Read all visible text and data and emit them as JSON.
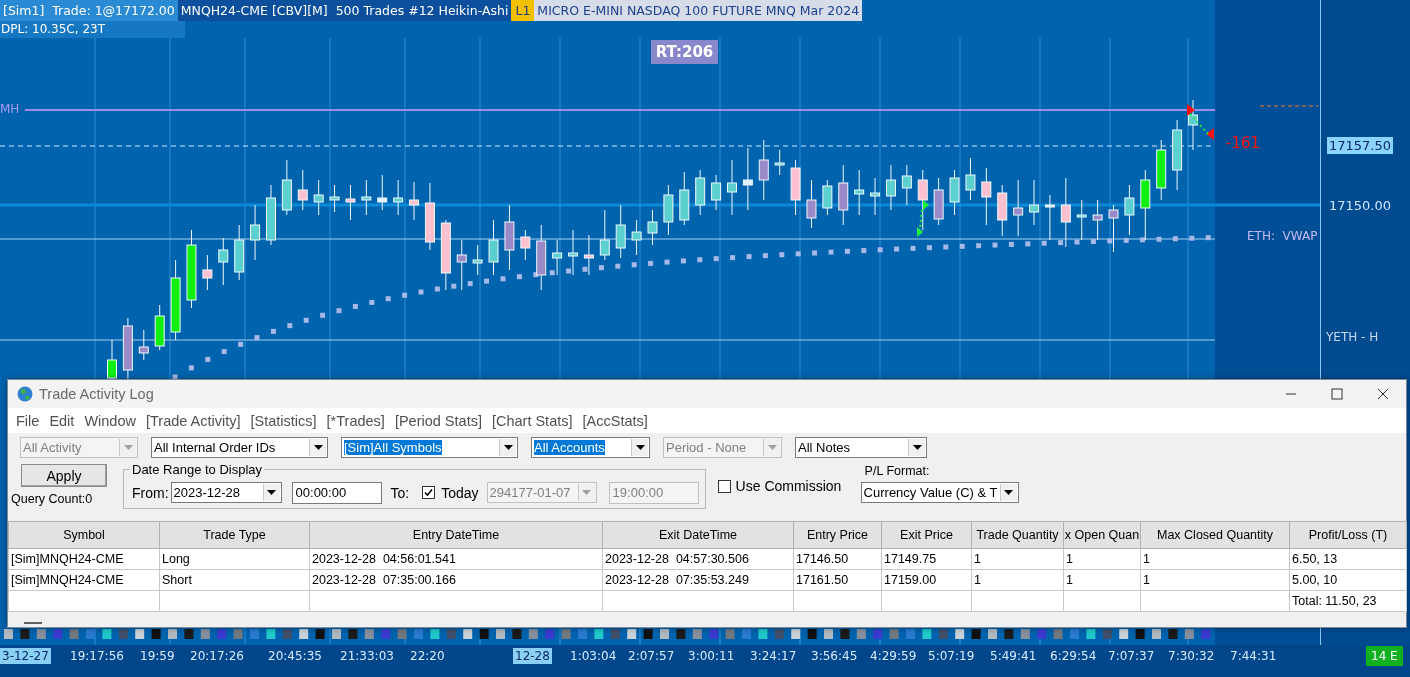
{
  "chart": {
    "header": [
      {
        "text": "[Sim1]  Trade: 1@17172.00",
        "kind": "account"
      },
      {
        "text": "MNQH24-CME [CBV][M]  500 Trades #12 Heikin-Ashi",
        "kind": "symbol"
      },
      {
        "text": "L1",
        "kind": "badge"
      },
      {
        "text": "MICRO E-MINI NASDAQ 100 FUTURE MNQ Mar 2024",
        "kind": "description"
      }
    ],
    "dpl": "DPL: 10.35C, 23T",
    "rt_label": "RT:206",
    "high_label": "MH",
    "pl_marker": "-161",
    "vwap_label": "ETH:  VWAP"
  },
  "price_axis": {
    "labels": [
      {
        "text": "17157.50",
        "highlighted": true
      },
      {
        "text": "17150.00",
        "highlighted": false
      }
    ],
    "yeth_label": "YETH - H"
  },
  "time_axis": {
    "labels": [
      {
        "text": "3-12-27",
        "highlighted": true
      },
      {
        "text": "19:17:56",
        "highlighted": false
      },
      {
        "text": "19:59",
        "highlighted": false
      },
      {
        "text": "20:17:26",
        "highlighted": false
      },
      {
        "text": "20:45:35",
        "highlighted": false
      },
      {
        "text": "21:33:03",
        "highlighted": false
      },
      {
        "text": "22:20",
        "highlighted": false
      },
      {
        "text": "12-28",
        "highlighted": true
      },
      {
        "text": "1:03:04",
        "highlighted": false
      },
      {
        "text": "2:07:57",
        "highlighted": false
      },
      {
        "text": "3:00:11",
        "highlighted": false
      },
      {
        "text": "3:24:17",
        "highlighted": false
      },
      {
        "text": "3:56:45",
        "highlighted": false
      },
      {
        "text": "4:29:59",
        "highlighted": false
      },
      {
        "text": "5:07:19",
        "highlighted": false
      },
      {
        "text": "5:49:41",
        "highlighted": false
      },
      {
        "text": "6:29:54",
        "highlighted": false
      },
      {
        "text": "7:07:37",
        "highlighted": false
      },
      {
        "text": "7:30:32",
        "highlighted": false
      },
      {
        "text": "7:44:31",
        "highlighted": false
      }
    ],
    "status_badge": "14 E"
  },
  "log_window": {
    "title": "Trade Activity Log",
    "menu": [
      "File",
      "Edit",
      "Window",
      "[Trade Activity]",
      "[Statistics]",
      "[*Trades]",
      "[Period Stats]",
      "[Chart Stats]",
      "[AccStats]"
    ],
    "filters": [
      {
        "value": "All Activity",
        "disabled": true,
        "highlighted": false
      },
      {
        "value": "All Internal Order IDs",
        "disabled": false,
        "highlighted": false
      },
      {
        "value": "[Sim]All Symbols",
        "disabled": false,
        "highlighted": true
      },
      {
        "value": "All Accounts",
        "disabled": false,
        "highlighted": true
      },
      {
        "value": "Period - None",
        "disabled": true,
        "highlighted": false
      },
      {
        "value": "All Notes",
        "disabled": false,
        "highlighted": false
      }
    ],
    "apply_button": "Apply",
    "query_count": "Query Count:0",
    "date_range": {
      "legend": "Date Range to Display",
      "from_label": "From:",
      "from_date": "2023-12-28",
      "from_time": "00:00:00",
      "to_label": "To:",
      "today_checked": true,
      "today_label": "Today",
      "to_date": "294177-01-07",
      "to_time": "19:00:00"
    },
    "use_commission": {
      "label": "Use Commission",
      "checked": false
    },
    "pl_format": {
      "label": "P/L Format:",
      "value": "Currency Value (C) & T"
    },
    "table": {
      "columns": [
        "Symbol",
        "Trade Type",
        "Entry DateTime",
        "Exit DateTime",
        "Entry Price",
        "Exit Price",
        "Trade Quantity",
        "x Open Quan",
        "Max Closed Quantity",
        "Profit/Loss (T)"
      ],
      "rows": [
        [
          "[Sim]MNQH24-CME",
          "Long",
          "2023-12-28  04:56:01.541",
          "2023-12-28  04:57:30.506",
          "17146.50",
          "17149.75",
          "1",
          "1",
          "1",
          "6.50, 13"
        ],
        [
          "[Sim]MNQH24-CME",
          "Short",
          "2023-12-28  07:35:00.166",
          "2023-12-28  07:35:53.249",
          "17161.50",
          "17159.00",
          "1",
          "1",
          "1",
          "5.00, 10"
        ]
      ],
      "total": "Total: 11.50, 23"
    }
  }
}
